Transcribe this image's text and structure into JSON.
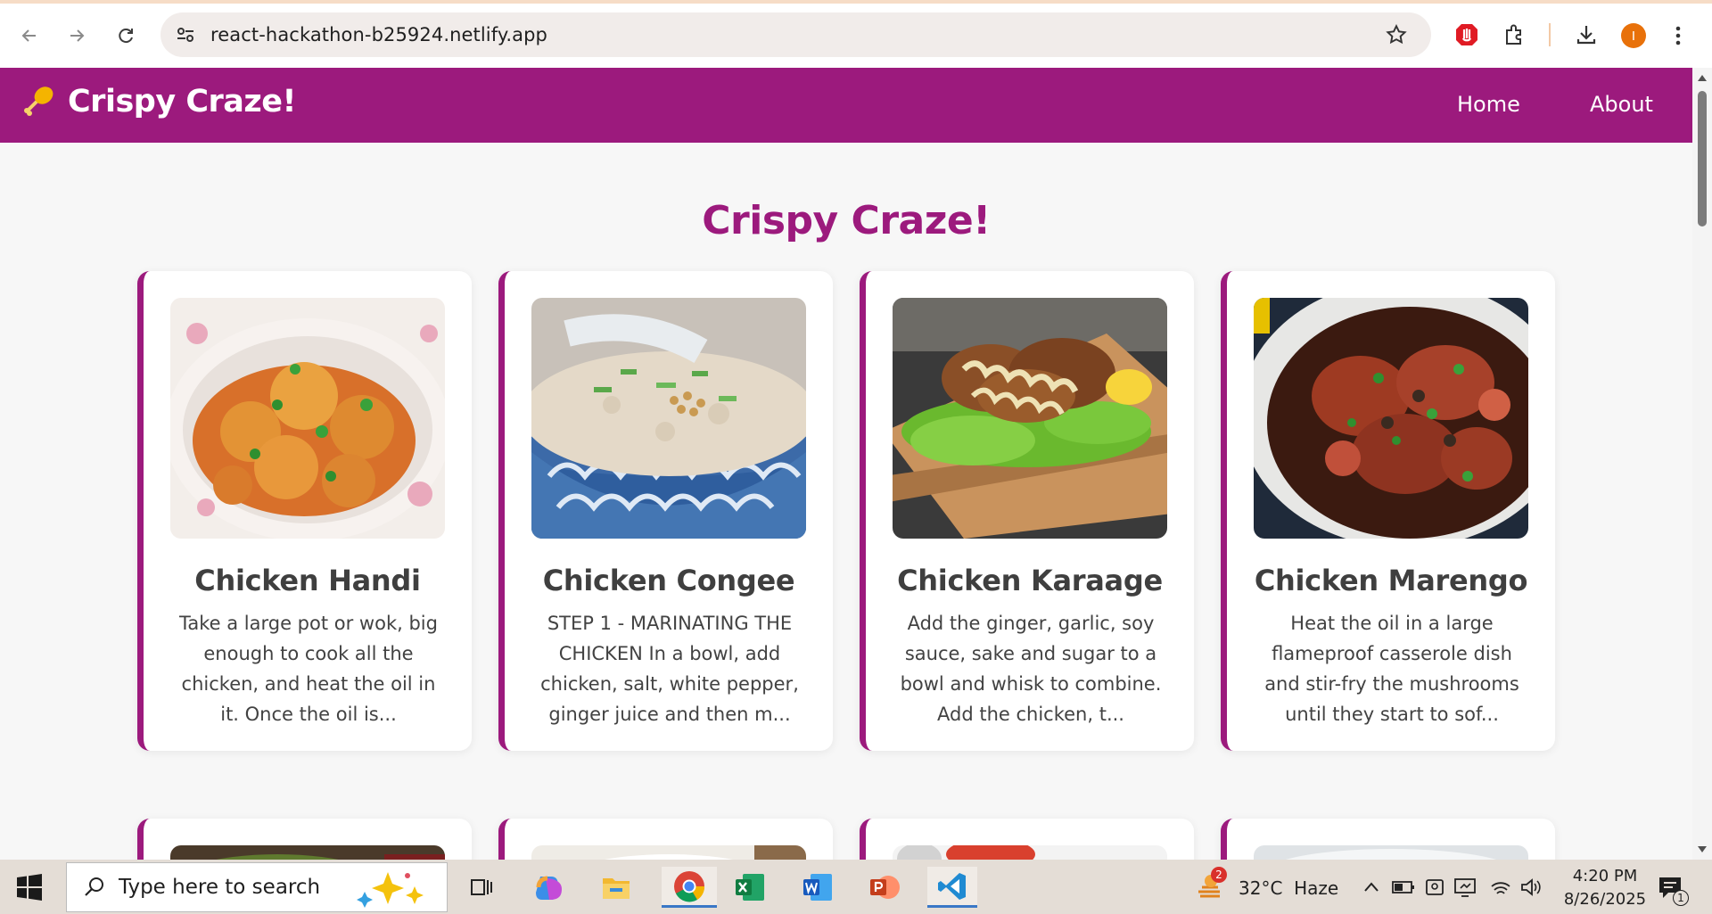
{
  "browser": {
    "url": "react-hackathon-b25924.netlify.app",
    "profile_initial": "I",
    "icons": [
      "back-icon",
      "forward-icon",
      "reload-icon",
      "site-info-icon",
      "bookmark-star-icon",
      "adblock-icon",
      "extensions-icon",
      "downloads-icon",
      "menu-icon"
    ]
  },
  "site": {
    "brand": "Crispy Craze!",
    "nav": {
      "home": "Home",
      "about": "About"
    },
    "heading": "Crispy Craze!",
    "accent": "#9c1a7d",
    "recipes": [
      {
        "title": "Chicken Handi",
        "desc": "Take a large pot or wok, big enough to cook all the chicken, and heat the oil in it. Once the oil is..."
      },
      {
        "title": "Chicken Congee",
        "desc": "STEP 1 - MARINATING THE CHICKEN In a bowl, add chicken, salt, white pepper, ginger juice and then m..."
      },
      {
        "title": "Chicken Karaage",
        "desc": "Add the ginger, garlic, soy sauce, sake and sugar to a bowl and whisk to combine. Add the chicken, t..."
      },
      {
        "title": "Chicken Marengo",
        "desc": "Heat the oil in a large flameproof casserole dish and stir-fry the mushrooms until they start to sof..."
      }
    ]
  },
  "taskbar": {
    "search_placeholder": "Type here to search",
    "weather_badge": "2",
    "weather": "32°C  Haze",
    "time": "4:20 PM",
    "date": "8/26/2025",
    "notification_count": "1"
  }
}
